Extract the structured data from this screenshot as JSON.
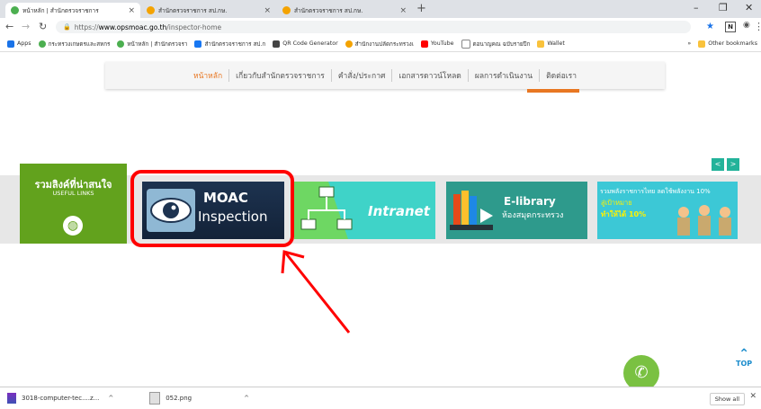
{
  "browser": {
    "tabs": [
      {
        "title": "หน้าหลัก | สำนักตรวจราชการ",
        "active": true,
        "favicon_color": "#4caf50"
      },
      {
        "title": "สำนักตรวจราชการ สป.กษ.",
        "active": false,
        "favicon_color": "#f4a300"
      },
      {
        "title": "สำนักตรวจราชการ สป.กษ.",
        "active": false,
        "favicon_color": "#f4a300"
      }
    ],
    "url_scheme": "https://",
    "url_host": "www.opsmoac.go.th",
    "url_path": "/inspector-home",
    "extension_label": "N",
    "bookmarks": [
      {
        "label": "Apps",
        "color": "#1a73e8"
      },
      {
        "label": "กระทรวงเกษตรและสหกร",
        "color": "#4caf50"
      },
      {
        "label": "หน้าหลัก | สำนักตรวจรา",
        "color": "#4caf50"
      },
      {
        "label": "สำนักตรวจราชการ สป.ก",
        "color": "#1877f2"
      },
      {
        "label": "QR Code Generator",
        "color": "#444444"
      },
      {
        "label": "สำนักงานปลัดกระทรวงเ",
        "color": "#f4a300"
      },
      {
        "label": "YouTube",
        "color": "#ff0000"
      },
      {
        "label": "ตอนาญคณ ฉบับรายปีก",
        "color": "#888888"
      },
      {
        "label": "Wallet",
        "color": "#f9c23c"
      }
    ],
    "other_bookmarks": "Other bookmarks",
    "more_bookmarks": "»"
  },
  "website": {
    "nav": [
      "หน้าหลัก",
      "เกี่ยวกับสำนักตรวจราชการ",
      "คำสั่ง/ประกาศ",
      "เอกสารดาวน์โหลด",
      "ผลการดำเนินงาน",
      "ติดต่อเรา"
    ],
    "accent": "#e87722",
    "useful_links": {
      "title": "รวมลิงค์ที่น่าสนใจ",
      "subtitle": "USEFUL LINKS"
    },
    "banners": {
      "moac": {
        "line1": "MOAC",
        "line2": "Inspection"
      },
      "intranet": {
        "label": "Intranet"
      },
      "elibrary": {
        "line1": "E-library",
        "line2": "ห้องสมุดกระทรวง"
      },
      "thai10": {
        "line1": "รวมพลังราชการไทย ลดใช้พลังงาน 10%",
        "line2": "สู่เป้าหมาย",
        "line3": "ทำให้ได้ 10%"
      }
    },
    "carousel": {
      "prev": "<",
      "next": ">"
    },
    "top_label": "TOP",
    "highlight_color": "#ff0000"
  },
  "downloads": {
    "items": [
      {
        "name": "3018-computer-tec....z..."
      },
      {
        "name": "052.png"
      }
    ],
    "show_all": "Show all"
  }
}
